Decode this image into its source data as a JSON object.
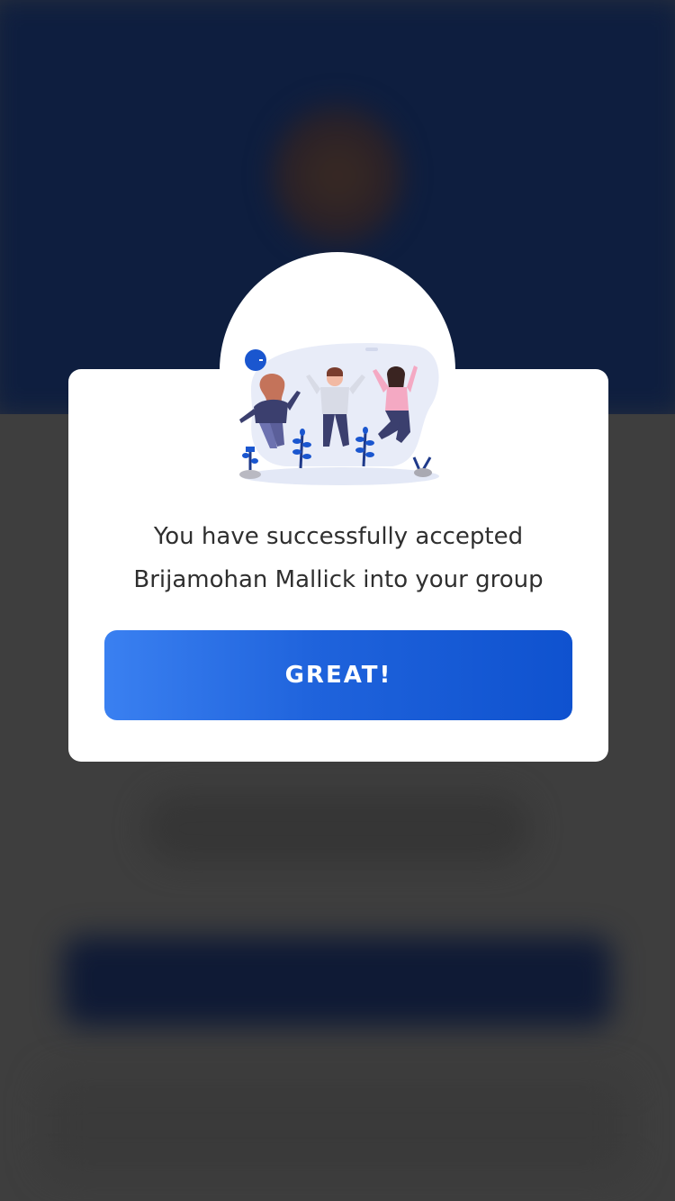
{
  "dialog": {
    "message_line_1": "You have successfully accepted",
    "message_line_2": "Brijamohan Mallick into your group",
    "confirm_label": "GREAT!"
  },
  "colors": {
    "overlay_background": "#3d3d3d",
    "header_background": "#0e1e3f",
    "dialog_background": "#ffffff",
    "button_gradient_start": "#3a80f1",
    "button_gradient_end": "#0f52cf",
    "button_text": "#ffffff",
    "message_text": "#2f2f2f",
    "illustration_accent": "#1a56cf"
  },
  "icons": {
    "illustration": "celebration-jumping-people-icon"
  }
}
